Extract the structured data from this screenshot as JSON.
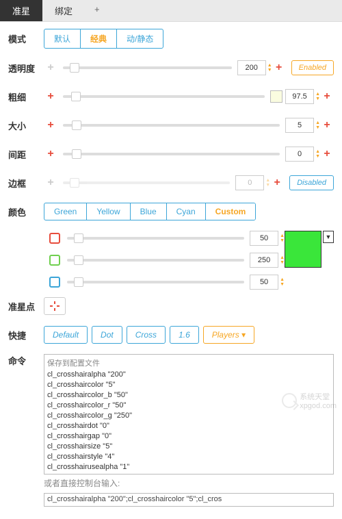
{
  "tabs": {
    "items": [
      "准星",
      "绑定"
    ],
    "plus": "+"
  },
  "mode": {
    "label": "模式",
    "options": [
      "默认",
      "经典",
      "动/静态"
    ],
    "selected": 1
  },
  "alpha": {
    "label": "透明度",
    "value": "200",
    "status": "Enabled"
  },
  "thickness": {
    "label": "粗细",
    "value": "97.5"
  },
  "size": {
    "label": "大小",
    "value": "5"
  },
  "gap": {
    "label": "间距",
    "value": "0"
  },
  "outline": {
    "label": "边框",
    "value": "0",
    "status": "Disabled"
  },
  "color": {
    "label": "颜色",
    "options": [
      "Green",
      "Yellow",
      "Blue",
      "Cyan",
      "Custom"
    ],
    "selected": 4,
    "r": "50",
    "g": "250",
    "b": "50"
  },
  "dot": {
    "label": "准星点"
  },
  "quick": {
    "label": "快捷",
    "buttons": [
      "Default",
      "Dot",
      "Cross",
      "1.6"
    ],
    "players": "Players"
  },
  "cmd": {
    "label": "命令",
    "save_title": "保存到配置文件",
    "lines": [
      "cl_crosshairalpha \"200\"",
      "cl_crosshaircolor \"5\"",
      "cl_crosshaircolor_b \"50\"",
      "cl_crosshaircolor_r \"50\"",
      "cl_crosshaircolor_g \"250\"",
      "cl_crosshairdot \"0\"",
      "cl_crosshairgap \"0\"",
      "cl_crosshairsize \"5\"",
      "cl_crosshairstyle \"4\"",
      "cl_crosshairusealpha \"1\""
    ],
    "inline_title": "或者直接控制台输入:",
    "inline": "cl_crosshairalpha \"200\";cl_crosshaircolor \"5\";cl_cros"
  },
  "watermark": {
    "text": "系统天堂",
    "site": "xpgod.com"
  }
}
